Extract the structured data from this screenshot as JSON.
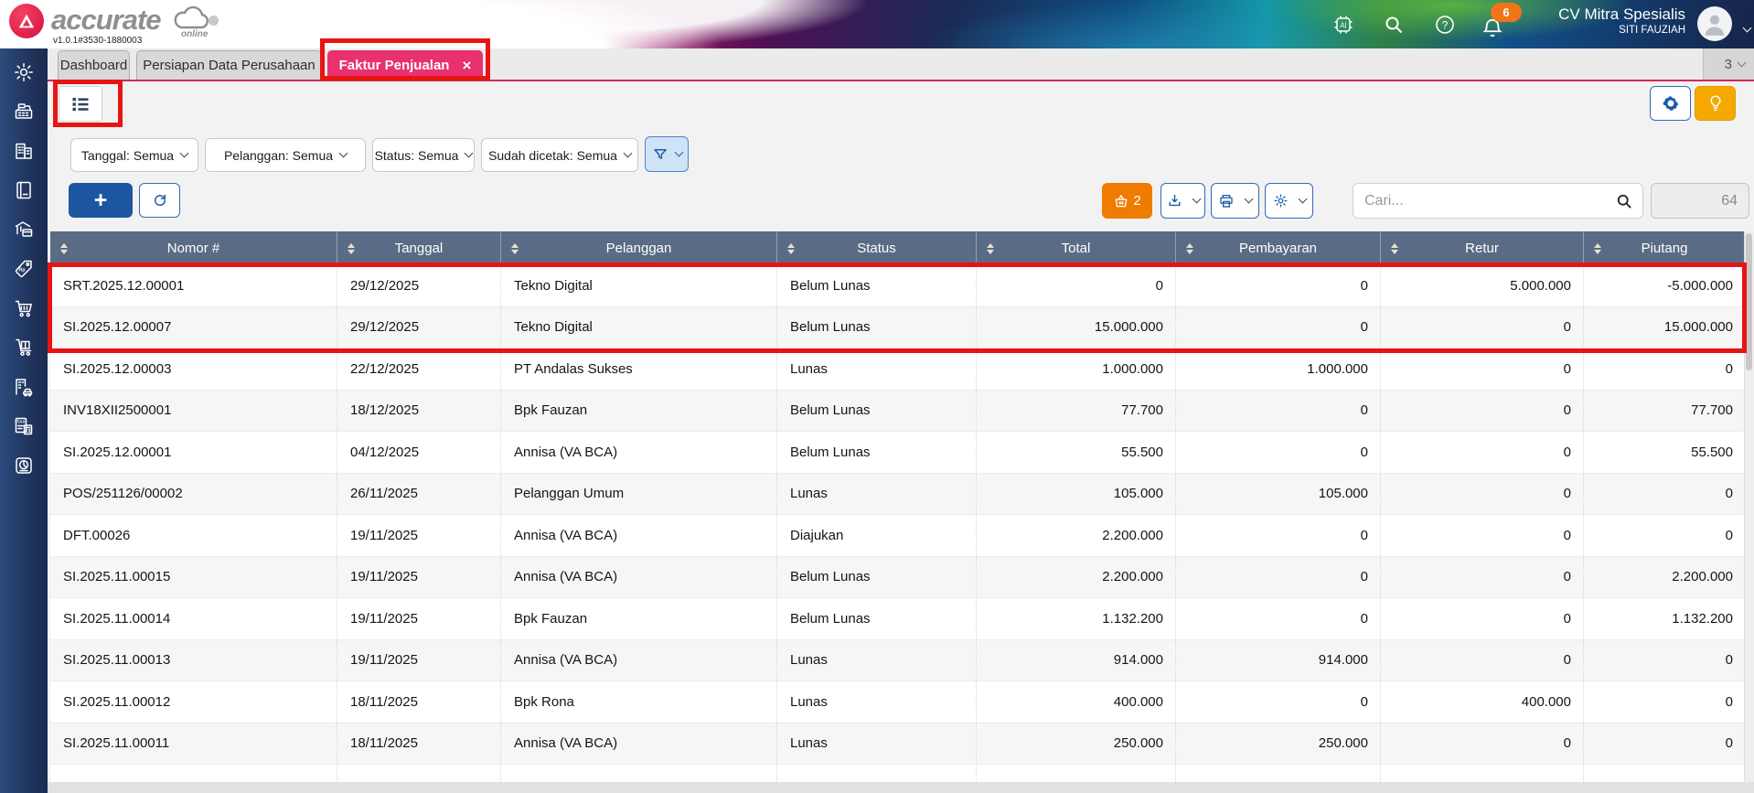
{
  "header": {
    "brand": "accurate",
    "brand_sub": "online",
    "version": "v1.0.1#3530-1880003",
    "company_name": "CV Mitra Spesialis",
    "user_name": "SITI FAUZIAH",
    "notification_badge": "6"
  },
  "tab_bar": {
    "tabs": [
      {
        "label": "Dashboard"
      },
      {
        "label": "Persiapan Data Perusahaan"
      },
      {
        "label": "Faktur Penjualan",
        "close": "×"
      }
    ],
    "right_count": "3"
  },
  "sidebar": {
    "icons": [
      "settings",
      "cashier",
      "company",
      "ledger",
      "cash-bank",
      "sales",
      "purchase",
      "inventory",
      "fixed-asset",
      "tax",
      "report"
    ]
  },
  "filters": {
    "date": "Tanggal: Semua",
    "customer": "Pelanggan: Semua",
    "status": "Status: Semua",
    "printed": "Sudah dicetak: Semua"
  },
  "toolbar": {
    "add_label": "+",
    "cart_count": "2",
    "search_placeholder": "Cari...",
    "record_count": "64"
  },
  "table": {
    "columns": [
      "Nomor #",
      "Tanggal",
      "Pelanggan",
      "Status",
      "Total",
      "Pembayaran",
      "Retur",
      "Piutang"
    ],
    "rows": [
      [
        "SRT.2025.12.00001",
        "29/12/2025",
        "Tekno Digital",
        "Belum Lunas",
        "0",
        "0",
        "5.000.000",
        "-5.000.000"
      ],
      [
        "SI.2025.12.00007",
        "29/12/2025",
        "Tekno Digital",
        "Belum Lunas",
        "15.000.000",
        "0",
        "0",
        "15.000.000"
      ],
      [
        "SI.2025.12.00003",
        "22/12/2025",
        "PT Andalas Sukses",
        "Lunas",
        "1.000.000",
        "1.000.000",
        "0",
        "0"
      ],
      [
        "INV18XII2500001",
        "18/12/2025",
        "Bpk Fauzan",
        "Belum Lunas",
        "77.700",
        "0",
        "0",
        "77.700"
      ],
      [
        "SI.2025.12.00001",
        "04/12/2025",
        "Annisa (VA BCA)",
        "Belum Lunas",
        "55.500",
        "0",
        "0",
        "55.500"
      ],
      [
        "POS/251126/00002",
        "26/11/2025",
        "Pelanggan Umum",
        "Lunas",
        "105.000",
        "105.000",
        "0",
        "0"
      ],
      [
        "DFT.00026",
        "19/11/2025",
        "Annisa (VA BCA)",
        "Diajukan",
        "2.200.000",
        "0",
        "0",
        "0"
      ],
      [
        "SI.2025.11.00015",
        "19/11/2025",
        "Annisa (VA BCA)",
        "Belum Lunas",
        "2.200.000",
        "0",
        "0",
        "2.200.000"
      ],
      [
        "SI.2025.11.00014",
        "19/11/2025",
        "Bpk Fauzan",
        "Belum Lunas",
        "1.132.200",
        "0",
        "0",
        "1.132.200"
      ],
      [
        "SI.2025.11.00013",
        "19/11/2025",
        "Annisa (VA BCA)",
        "Lunas",
        "914.000",
        "914.000",
        "0",
        "0"
      ],
      [
        "SI.2025.11.00012",
        "18/11/2025",
        "Bpk Rona",
        "Lunas",
        "400.000",
        "0",
        "400.000",
        "0"
      ],
      [
        "SI.2025.11.00011",
        "18/11/2025",
        "Annisa (VA BCA)",
        "Lunas",
        "250.000",
        "250.000",
        "0",
        "0"
      ]
    ]
  },
  "colors": {
    "accent_pink": "#e8316e",
    "annotation_red": "#e81414",
    "table_header": "#5a6c85",
    "primary_blue": "#1d5ba8",
    "cart_orange": "#ef7b00",
    "bulb_amber": "#f5a800",
    "badge_orange": "#f07418"
  }
}
